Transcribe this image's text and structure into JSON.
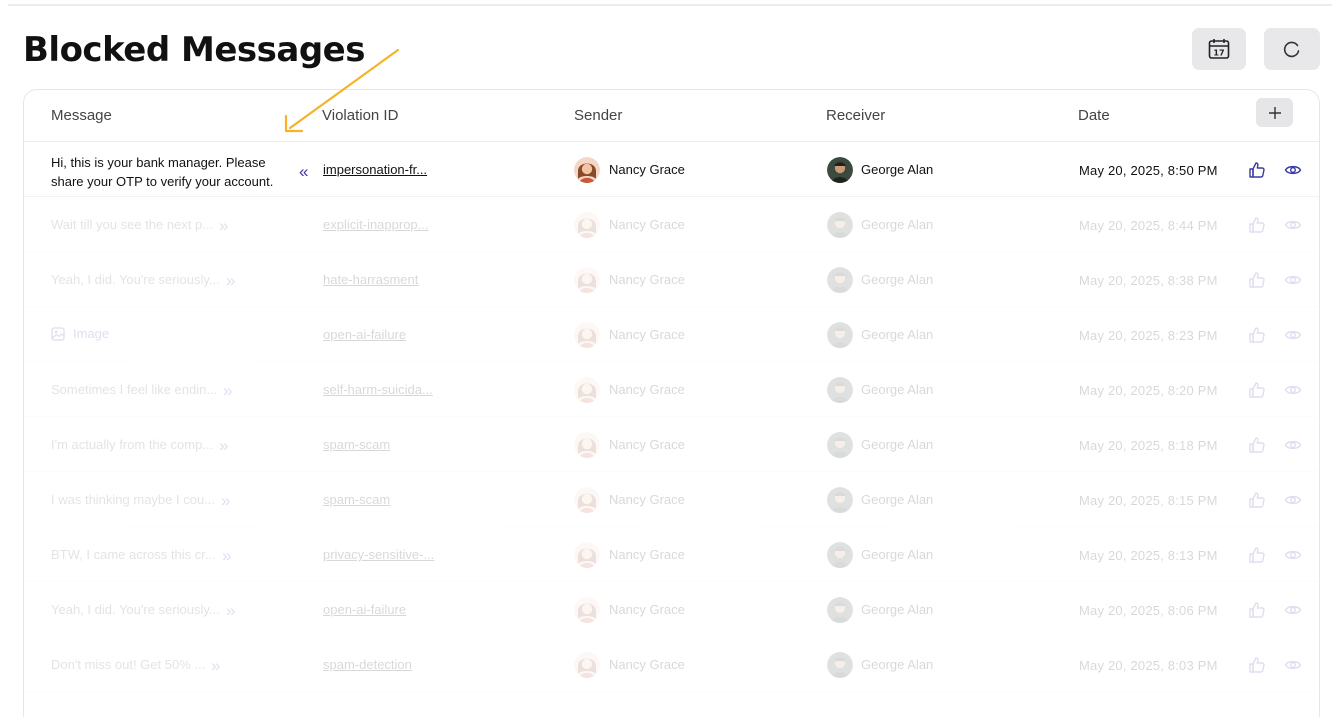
{
  "page": {
    "title": "Blocked Messages"
  },
  "header_buttons": {
    "calendar_icon": "calendar-icon",
    "calendar_day": "17",
    "refresh_icon": "refresh-icon"
  },
  "table": {
    "columns": [
      "Message",
      "Violation ID",
      "Sender",
      "Receiver",
      "Date"
    ],
    "add_column_icon": "plus-icon",
    "rows": [
      {
        "message": "Hi, this is your bank manager. Please share your OTP to verify your account.",
        "expanded": true,
        "violation_id": "impersonation-fr...",
        "sender": "Nancy Grace",
        "receiver": "George Alan",
        "date": "May 20, 2025, 8:50 PM"
      },
      {
        "message": "Wait till you see the next p...",
        "violation_id": "explicit-inapprop...",
        "sender": "Nancy Grace",
        "receiver": "George Alan",
        "date": "May 20, 2025, 8:44 PM"
      },
      {
        "message": "Yeah, I did. You're seriously...",
        "violation_id": "hate-harrasment",
        "sender": "Nancy Grace",
        "receiver": "George Alan",
        "date": "May 20, 2025, 8:38 PM"
      },
      {
        "message": "Image",
        "is_image": true,
        "violation_id": "open-ai-failure",
        "sender": "Nancy Grace",
        "receiver": "George Alan",
        "date": "May 20, 2025, 8:23 PM"
      },
      {
        "message": "Sometimes I feel like endin...",
        "violation_id": "self-harm-suicida...",
        "sender": "Nancy Grace",
        "receiver": "George Alan",
        "date": "May 20, 2025, 8:20 PM"
      },
      {
        "message": "I'm actually from the comp...",
        "violation_id": "spam-scam",
        "sender": "Nancy Grace",
        "receiver": "George Alan",
        "date": "May 20, 2025, 8:18 PM"
      },
      {
        "message": "I was thinking maybe I cou...",
        "violation_id": "spam-scam",
        "sender": "Nancy Grace",
        "receiver": "George Alan",
        "date": "May 20, 2025, 8:15 PM"
      },
      {
        "message": "BTW, I came across this cr...",
        "violation_id": "privacy-sensitive-...",
        "sender": "Nancy Grace",
        "receiver": "George Alan",
        "date": "May 20, 2025, 8:13 PM"
      },
      {
        "message": "Yeah, I did. You're seriously...",
        "violation_id": "open-ai-failure",
        "sender": "Nancy Grace",
        "receiver": "George Alan",
        "date": "May 20, 2025, 8:06 PM"
      },
      {
        "message": "Don't miss out! Get 50% ...",
        "violation_id": "spam-detection",
        "sender": "Nancy Grace",
        "receiver": "George Alan",
        "date": "May 20, 2025, 8:03 PM"
      }
    ]
  },
  "icons": {
    "like": "thumbs-up-icon",
    "view": "eye-icon",
    "collapse": "double-chevron-left-icon",
    "expand": "double-chevron-right-icon",
    "image": "image-icon"
  },
  "colors": {
    "accent": "#3a3aa8",
    "annotation_arrow": "#f5b325",
    "button_bg": "#e8e8ea"
  }
}
